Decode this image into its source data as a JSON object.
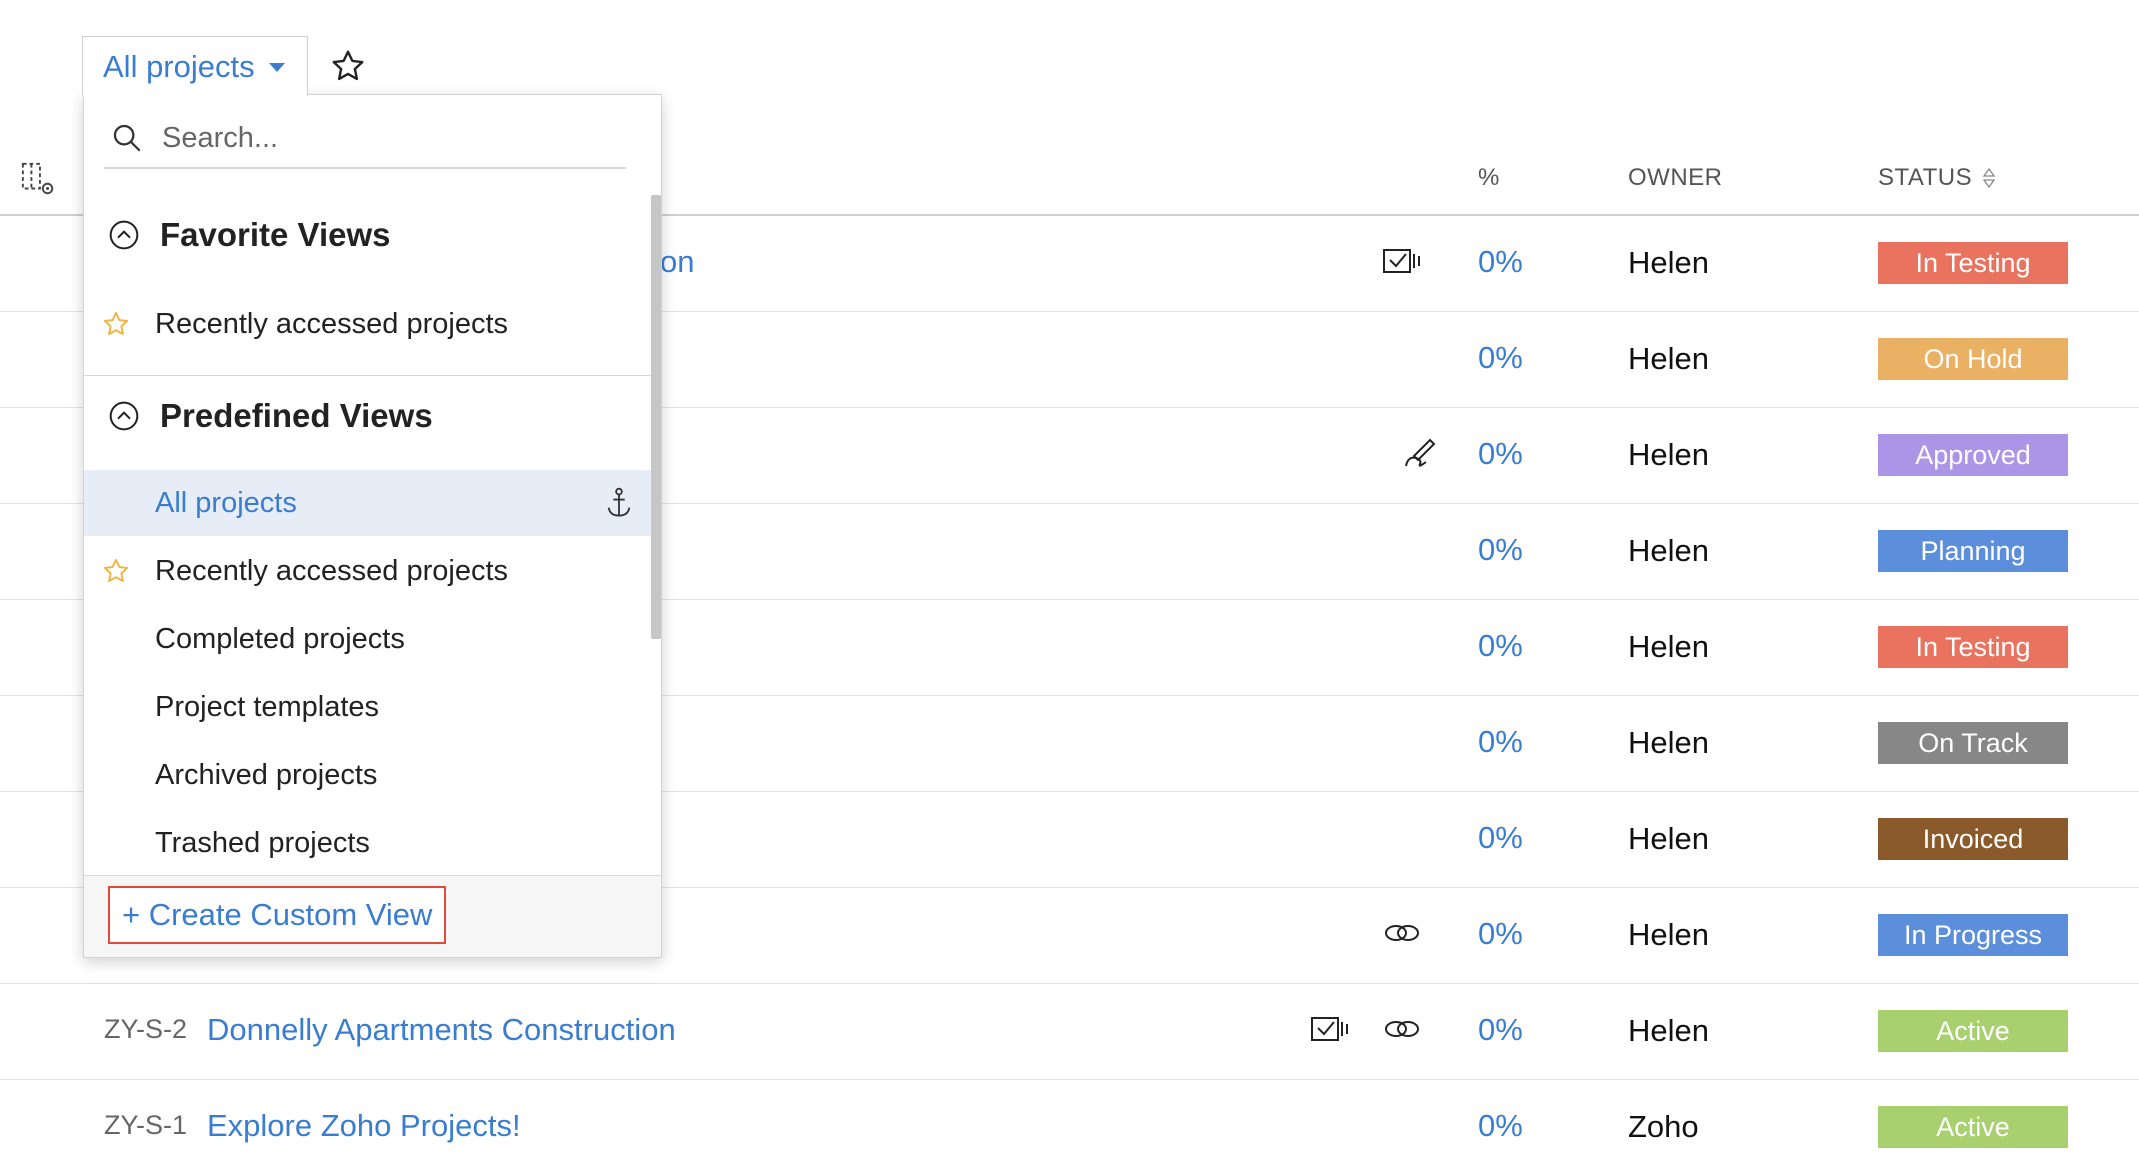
{
  "view_switcher": {
    "label": "All projects"
  },
  "table": {
    "columns": {
      "percent": "%",
      "owner": "OWNER",
      "status": "STATUS"
    },
    "rows": [
      {
        "id": "",
        "name": "on",
        "percent": "0%",
        "owner": "Helen",
        "status": "In Testing",
        "status_color": "#e9735f",
        "icons": [
          "task-check-icon"
        ]
      },
      {
        "id": "",
        "name": "",
        "percent": "0%",
        "owner": "Helen",
        "status": "On Hold",
        "status_color": "#eab064",
        "icons": []
      },
      {
        "id": "",
        "name": "",
        "percent": "0%",
        "owner": "Helen",
        "status": "Approved",
        "status_color": "#ac95e6",
        "icons": [
          "signature-icon"
        ]
      },
      {
        "id": "",
        "name": "",
        "percent": "0%",
        "owner": "Helen",
        "status": "Planning",
        "status_color": "#5c8fdb",
        "icons": []
      },
      {
        "id": "",
        "name": "",
        "percent": "0%",
        "owner": "Helen",
        "status": "In Testing",
        "status_color": "#e9735f",
        "icons": []
      },
      {
        "id": "",
        "name": "",
        "percent": "0%",
        "owner": "Helen",
        "status": "On Track",
        "status_color": "#878787",
        "icons": []
      },
      {
        "id": "",
        "name": "",
        "percent": "0%",
        "owner": "Helen",
        "status": "Invoiced",
        "status_color": "#8b5a2b",
        "icons": []
      },
      {
        "id": "",
        "name": "",
        "percent": "0%",
        "owner": "Helen",
        "status": "In Progress",
        "status_color": "#5c8fdb",
        "icons": [
          "link-icon"
        ]
      },
      {
        "id": "ZY-S-2",
        "name": "Donnelly Apartments Construction",
        "percent": "0%",
        "owner": "Helen",
        "status": "Active",
        "status_color": "#a8d06f",
        "icons": [
          "task-check-icon",
          "link-icon"
        ]
      },
      {
        "id": "ZY-S-1",
        "name": "Explore Zoho Projects!",
        "percent": "0%",
        "owner": "Zoho",
        "status": "Active",
        "status_color": "#a8d06f",
        "icons": []
      }
    ]
  },
  "dropdown": {
    "search_placeholder": "Search...",
    "favorite_heading": "Favorite Views",
    "favorite_items": [
      "Recently accessed projects"
    ],
    "predefined_heading": "Predefined Views",
    "predefined_items": [
      "All projects",
      "Recently accessed projects",
      "Completed projects",
      "Project templates",
      "Archived projects",
      "Trashed projects"
    ],
    "create_label": "+ Create Custom View"
  },
  "colors": {
    "accent": "#3a7dd0",
    "highlight_border": "#e1493b",
    "active_bg": "#e6edf6"
  }
}
